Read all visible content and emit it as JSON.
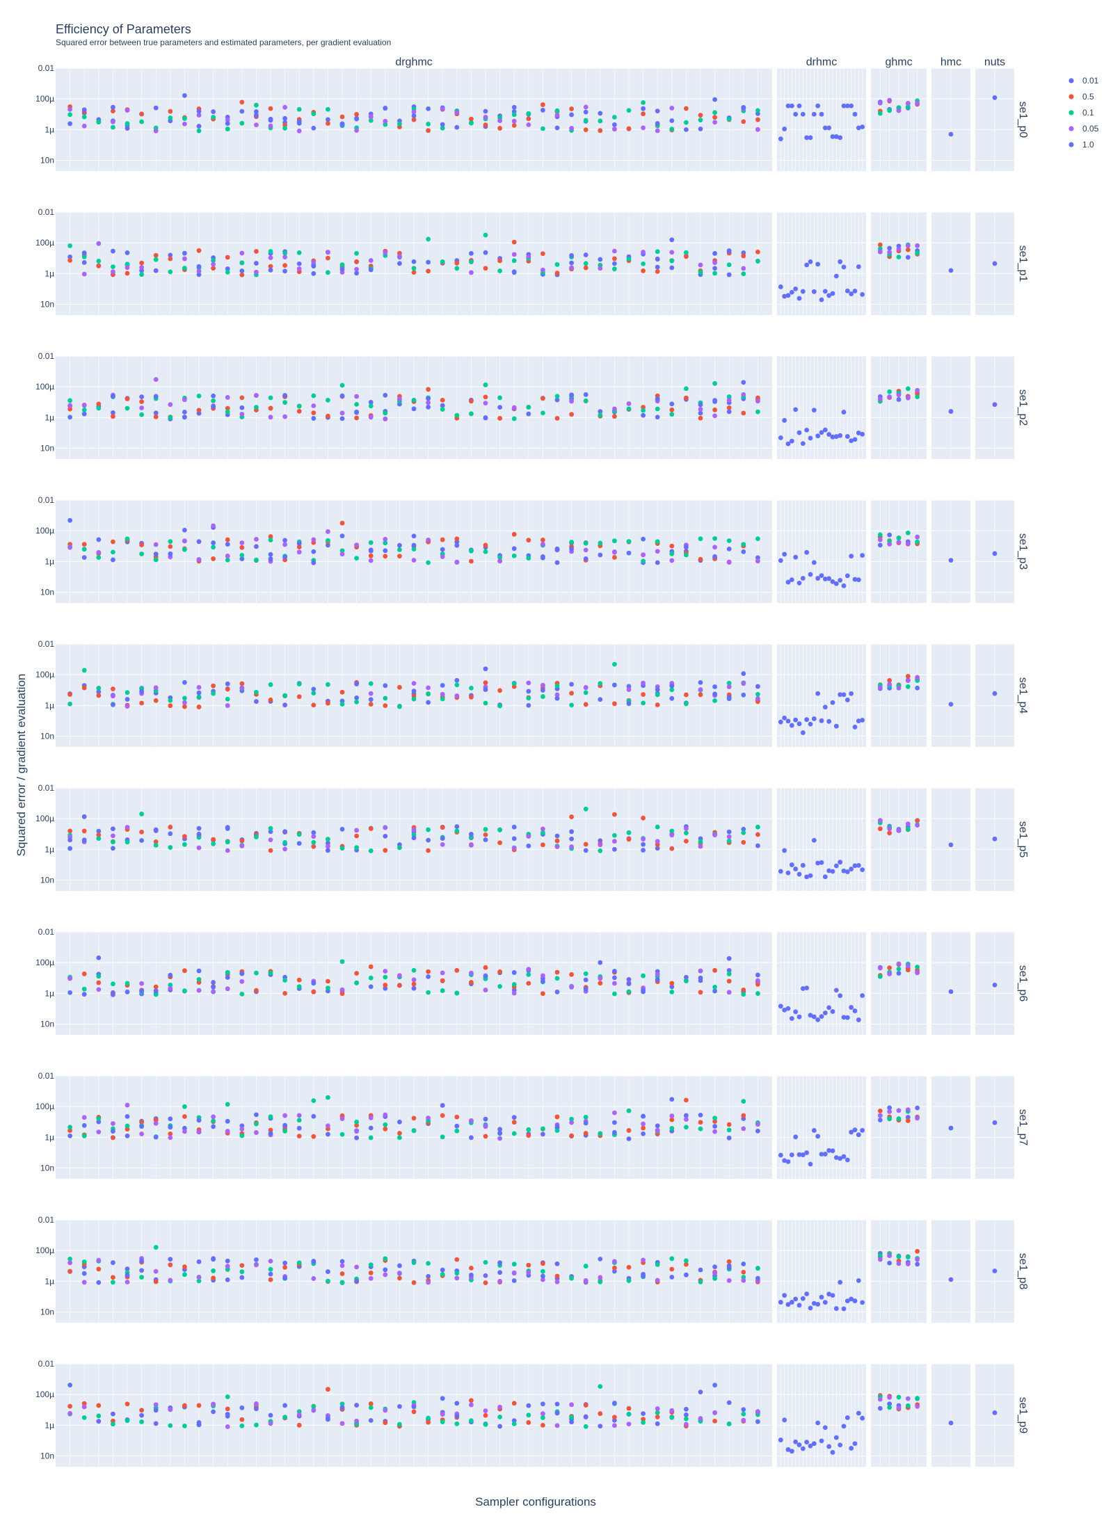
{
  "chart_data": {
    "type": "scatter",
    "title": "Efficiency of Parameters",
    "subtitle": "Squared error between true parameters and estimated parameters, per gradient evaluation",
    "xlabel": "Sampler configurations",
    "ylabel": "Squared error / gradient evaluation",
    "yscale": "log",
    "yticks": [
      {
        "value": 1e-08,
        "label": "10n"
      },
      {
        "value": 1e-06,
        "label": "1µ"
      },
      {
        "value": 0.0001,
        "label": "100µ"
      },
      {
        "value": 0.01,
        "label": "0.01"
      }
    ],
    "ylim": [
      2e-09,
      0.01
    ],
    "columns": [
      "drghmc",
      "drhmc",
      "ghmc",
      "hmc",
      "nuts"
    ],
    "rows": [
      "se1_p0",
      "se1_p1",
      "se1_p2",
      "se1_p3",
      "se1_p4",
      "se1_p5",
      "se1_p6",
      "se1_p7",
      "se1_p8",
      "se1_p9"
    ],
    "legend": {
      "placement": "top-right",
      "entries": [
        {
          "name": "0.01",
          "color": "#636efa"
        },
        {
          "name": "0.5",
          "color": "#ef553b"
        },
        {
          "name": "0.1",
          "color": "#00cc96"
        },
        {
          "name": "0.05",
          "color": "#ab63fa"
        },
        {
          "name": "1.0",
          "color": "#636efa"
        }
      ]
    },
    "approximate_panel_values": {
      "drghmc_note": "about 49 configurations per row, 3 to 5 series each, values between roughly 1e-7 and 1e-3",
      "drhmc_se1_p0": [
        2.5e-07,
        1.1e-06,
        3.5e-05,
        3.5e-05,
        1e-05,
        3.5e-05,
        1e-05,
        3e-07,
        3e-07,
        1e-05,
        3.5e-05,
        1e-05,
        1.3e-06,
        1.3e-06,
        3.5e-07,
        3.5e-07,
        3e-07,
        3.5e-05,
        3.5e-05,
        3.5e-05,
        1e-05,
        1.3e-06,
        1.5e-06
      ],
      "hmc": [
        5e-07,
        1.6e-06,
        2.5e-06,
        1.2e-06,
        1.2e-06,
        2e-06,
        1.3e-06,
        4e-06,
        1.3e-06,
        1.4e-06
      ],
      "nuts": [
        0.00012,
        4.5e-06,
        7e-06,
        3.3e-06,
        6e-06,
        4.8e-06,
        3.5e-06,
        9e-06,
        4.7e-06,
        6.5e-06
      ]
    }
  }
}
